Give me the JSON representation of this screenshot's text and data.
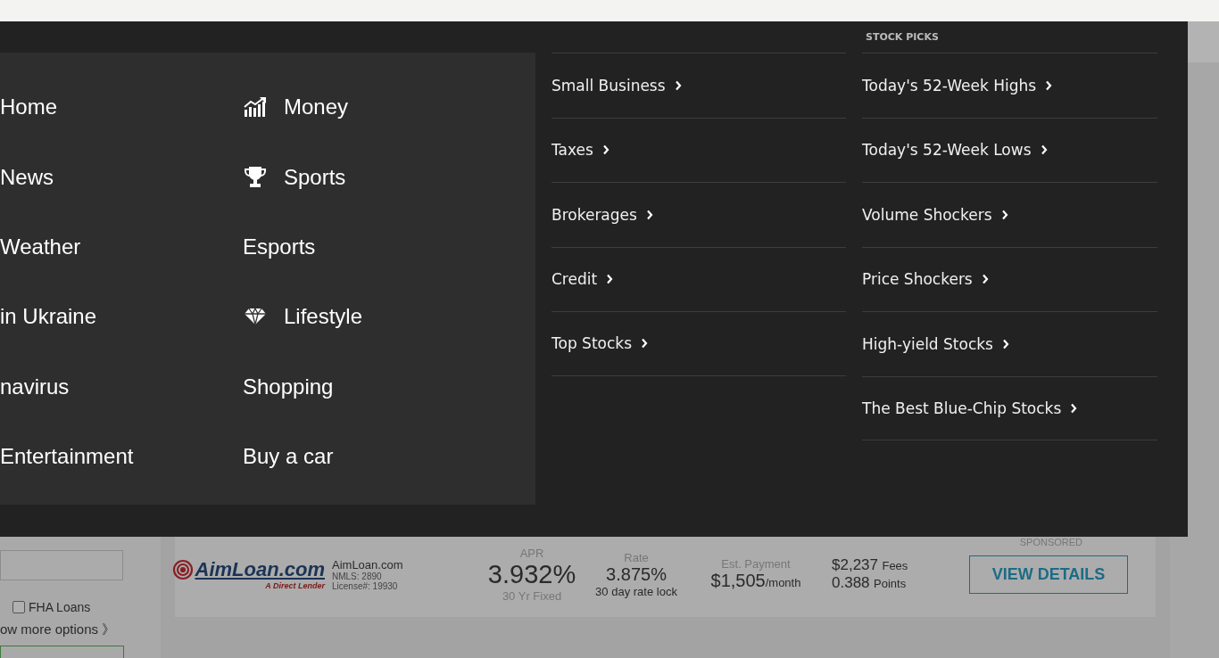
{
  "nav_primary": [
    {
      "label": "Home"
    },
    {
      "label": "News"
    },
    {
      "label": "Weather"
    },
    {
      "label": "in Ukraine"
    },
    {
      "label": "navirus"
    },
    {
      "label": "Entertainment"
    }
  ],
  "nav_secondary": [
    {
      "label": "Money"
    },
    {
      "label": "Sports"
    },
    {
      "label": "Esports"
    },
    {
      "label": "Lifestyle"
    },
    {
      "label": "Shopping"
    },
    {
      "label": "Buy a car"
    }
  ],
  "money_links": [
    "Small Business",
    "Taxes",
    "Brokerages",
    "Credit",
    "Top Stocks"
  ],
  "stock_picks": {
    "heading": "STOCK PICKS",
    "links": [
      "Today's 52-Week Highs",
      "Today's 52-Week Lows",
      "Volume Shockers",
      "Price Shockers",
      "High-yield Stocks",
      "The Best Blue-Chip Stocks"
    ]
  },
  "filters": {
    "checkbox": {
      "label": "FHA Loans",
      "checked": false
    },
    "more_link": "ow more options 》"
  },
  "offer": {
    "sponsored": "SPONSORED",
    "logo": "AimLoan.com",
    "tagline": "A Direct Lender",
    "lender": "AimLoan.com",
    "nmls": "NMLS: 2890",
    "license": "License#: 19930",
    "apr_label": "APR",
    "apr": "3.932%",
    "apr_note": "30 Yr Fixed",
    "rate_label": "Rate",
    "rate": "3.875%",
    "rate_note": "30 day rate lock",
    "payment_label": "Est. Payment",
    "payment": "$1,505",
    "payment_unit": "/month",
    "fees": "$2,237",
    "fees_label": "Fees",
    "points": "0.388",
    "points_label": "Points",
    "button": "VIEW DETAILS"
  }
}
